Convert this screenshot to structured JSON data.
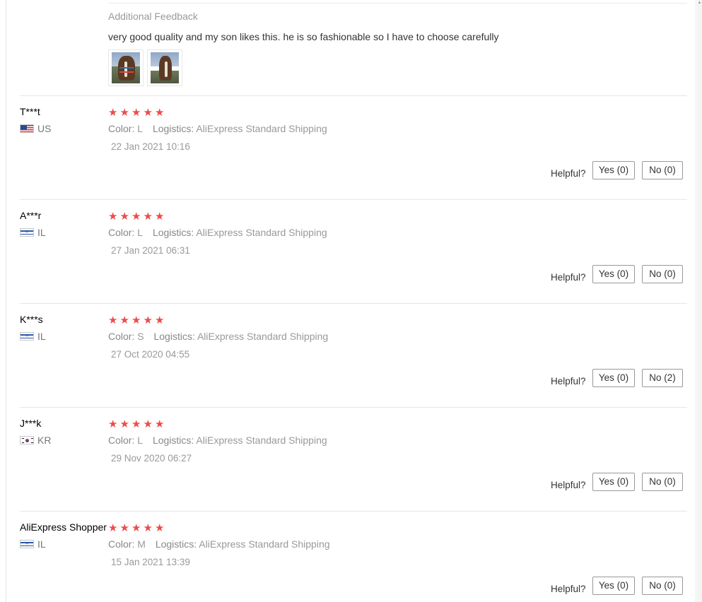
{
  "additional_feedback": {
    "title": "Additional Feedback",
    "text": "very good quality and my son likes this. he is so fashionable so I have to choose carefully",
    "photos": [
      "horse-photo-icon",
      "horse-photo-icon"
    ]
  },
  "labels": {
    "color": "Color:",
    "logistics": "Logistics:",
    "helpful": "Helpful?"
  },
  "reviews": [
    {
      "user": "T***t",
      "country": "US",
      "flag": "us",
      "rating": 5,
      "color": "L",
      "logistics": "AliExpress Standard Shipping",
      "date": "22 Jan 2021 10:16",
      "yes": "Yes (0)",
      "no": "No (0)"
    },
    {
      "user": "A***r",
      "country": "IL",
      "flag": "il",
      "rating": 5,
      "color": "L",
      "logistics": "AliExpress Standard Shipping",
      "date": "27 Jan 2021 06:31",
      "yes": "Yes (0)",
      "no": "No (0)"
    },
    {
      "user": "K***s",
      "country": "IL",
      "flag": "il",
      "rating": 5,
      "color": "S",
      "logistics": "AliExpress Standard Shipping",
      "date": "27 Oct 2020 04:55",
      "yes": "Yes (0)",
      "no": "No (2)"
    },
    {
      "user": "J***k",
      "country": "KR",
      "flag": "kr",
      "rating": 5,
      "color": "L",
      "logistics": "AliExpress Standard Shipping",
      "date": "29 Nov 2020 06:27",
      "yes": "Yes (0)",
      "no": "No (0)"
    },
    {
      "user": "AliExpress Shopper",
      "country": "IL",
      "flag": "il",
      "rating": 5,
      "color": "M",
      "logistics": "AliExpress Standard Shipping",
      "date": "15 Jan 2021 13:39",
      "yes": "Yes (0)",
      "no": "No (0)"
    }
  ],
  "colors": {
    "star": "#ef4a4a",
    "muted_text": "#999999",
    "divider": "#e6e6e6"
  }
}
